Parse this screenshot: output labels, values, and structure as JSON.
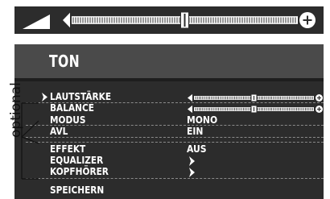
{
  "menu": {
    "title": "TON",
    "items": [
      {
        "label": "LAUTSTÄRKE",
        "value": "",
        "control": "slider",
        "level": 0.5,
        "selected": true
      },
      {
        "label": "BALANCE",
        "value": "",
        "control": "slider",
        "level": 0.5,
        "selected": false
      },
      {
        "label": "MODUS",
        "value": "MONO",
        "control": "text",
        "selected": false
      },
      {
        "label": "AVL",
        "value": "EIN",
        "control": "text",
        "selected": false
      },
      {
        "label": "EFFEKT",
        "value": "AUS",
        "control": "text",
        "selected": false
      },
      {
        "label": "EQUALIZER",
        "value": "",
        "control": "submenu",
        "selected": false
      },
      {
        "label": "KOPFHÖRER",
        "value": "",
        "control": "submenu",
        "selected": false
      },
      {
        "label": "SPEICHERN",
        "value": "",
        "control": "none",
        "selected": false
      }
    ]
  },
  "volume_bar": {
    "level": 0.5
  },
  "annotation": {
    "optional_label": "optional"
  },
  "colors": {
    "panel": "#2c2c2c",
    "header": "#4a4a4a",
    "text": "#ffffff",
    "annotation": "#111111"
  }
}
